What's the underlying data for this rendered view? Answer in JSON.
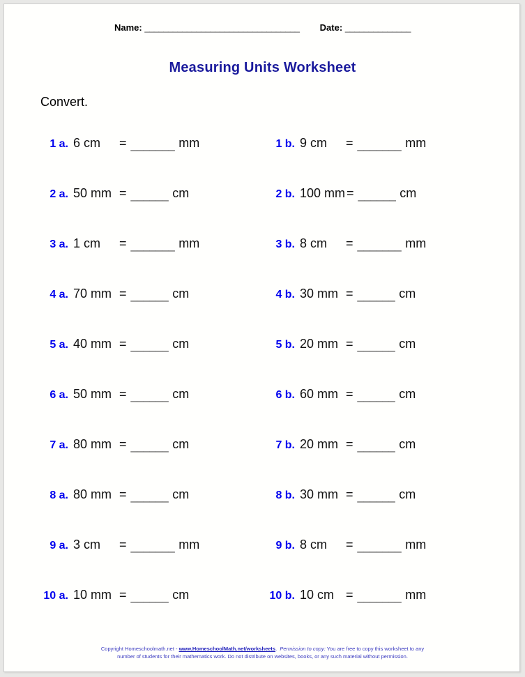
{
  "header": {
    "name_label": "Name:",
    "name_rule": "_________________________________",
    "date_label": "Date:",
    "date_rule": "______________"
  },
  "title": "Measuring Units Worksheet",
  "instruction": "Convert.",
  "colors": {
    "title": "#1a1a9c",
    "problem_label": "#0000ee",
    "footer": "#3a3ac0",
    "page_background": "#fffffd",
    "canvas_background": "#e8e8e6"
  },
  "problems": [
    {
      "a": {
        "label": "1 a.",
        "value": "6 cm",
        "equals": "=",
        "blank": "_______",
        "unit": "mm"
      },
      "b": {
        "label": "1 b.",
        "value": "9 cm",
        "equals": "=",
        "blank": "_______",
        "unit": "mm"
      }
    },
    {
      "a": {
        "label": "2 a.",
        "value": "50 mm",
        "equals": "=",
        "blank": "______",
        "unit": "cm"
      },
      "b": {
        "label": "2 b.",
        "value": "100 mm",
        "equals": "=",
        "blank": "______",
        "unit": "cm"
      }
    },
    {
      "a": {
        "label": "3 a.",
        "value": "1 cm",
        "equals": "=",
        "blank": "_______",
        "unit": "mm"
      },
      "b": {
        "label": "3 b.",
        "value": "8 cm",
        "equals": "=",
        "blank": "_______",
        "unit": "mm"
      }
    },
    {
      "a": {
        "label": "4 a.",
        "value": "70 mm",
        "equals": "=",
        "blank": "______",
        "unit": "cm"
      },
      "b": {
        "label": "4 b.",
        "value": "30 mm",
        "equals": "=",
        "blank": "______",
        "unit": "cm"
      }
    },
    {
      "a": {
        "label": "5 a.",
        "value": "40 mm",
        "equals": "=",
        "blank": "______",
        "unit": "cm"
      },
      "b": {
        "label": "5 b.",
        "value": "20 mm",
        "equals": "=",
        "blank": "______",
        "unit": "cm"
      }
    },
    {
      "a": {
        "label": "6 a.",
        "value": "50 mm",
        "equals": "=",
        "blank": "______",
        "unit": "cm"
      },
      "b": {
        "label": "6 b.",
        "value": "60 mm",
        "equals": "=",
        "blank": "______",
        "unit": "cm"
      }
    },
    {
      "a": {
        "label": "7 a.",
        "value": "80 mm",
        "equals": "=",
        "blank": "______",
        "unit": "cm"
      },
      "b": {
        "label": "7 b.",
        "value": "20 mm",
        "equals": "=",
        "blank": "______",
        "unit": "cm"
      }
    },
    {
      "a": {
        "label": "8 a.",
        "value": "80 mm",
        "equals": "=",
        "blank": "______",
        "unit": "cm"
      },
      "b": {
        "label": "8 b.",
        "value": "30 mm",
        "equals": "=",
        "blank": "______",
        "unit": "cm"
      }
    },
    {
      "a": {
        "label": "9 a.",
        "value": "3 cm",
        "equals": "=",
        "blank": "_______",
        "unit": "mm"
      },
      "b": {
        "label": "9 b.",
        "value": "8 cm",
        "equals": "=",
        "blank": "_______",
        "unit": "mm"
      }
    },
    {
      "a": {
        "label": "10 a.",
        "value": "10 mm",
        "equals": "=",
        "blank": "______",
        "unit": "cm"
      },
      "b": {
        "label": "10 b.",
        "value": "10 cm",
        "equals": "=",
        "blank": "_______",
        "unit": "mm"
      }
    }
  ],
  "footer": {
    "line1_pre": "Copyright Homeschoolmath.net - ",
    "link": "www.HomeschoolMath.net/worksheets",
    "line1_permission": "Permission to copy:",
    "line1_post": " You are free to copy this worksheet to any",
    "line2": "number of students for their mathematics work. Do not distribute on websites, books, or any such material without permission."
  }
}
